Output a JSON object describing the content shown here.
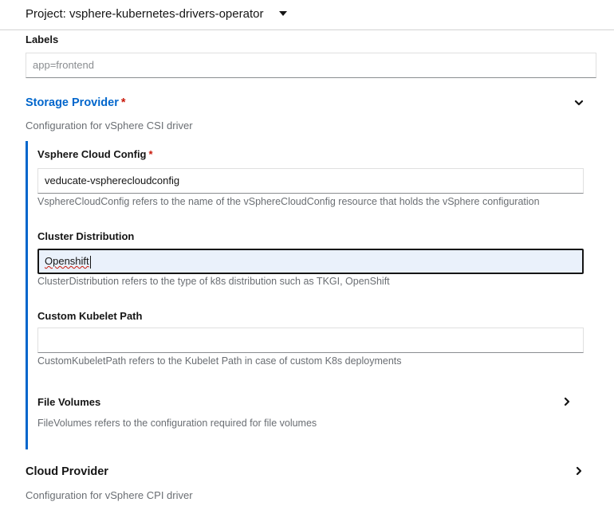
{
  "project": {
    "label": "Project: vsphere-kubernetes-drivers-operator"
  },
  "labels": {
    "label": "Labels",
    "placeholder": "app=frontend"
  },
  "storage_provider": {
    "title": "Storage Provider",
    "required_mark": "*",
    "description": "Configuration for vSphere CSI driver",
    "fields": {
      "cloud_config": {
        "label": "Vsphere Cloud Config",
        "required_mark": "*",
        "value": "veducate-vspherecloudconfig",
        "help": "VsphereCloudConfig refers to the name of the vSphereCloudConfig resource that holds the vSphere configuration"
      },
      "cluster_distribution": {
        "label": "Cluster Distribution",
        "value": "Openshift",
        "help": "ClusterDistribution refers to the type of k8s distribution such as TKGI, OpenShift"
      },
      "custom_kubelet_path": {
        "label": "Custom Kubelet Path",
        "value": "",
        "help": "CustomKubeletPath refers to the Kubelet Path in case of custom K8s deployments"
      },
      "file_volumes": {
        "title": "File Volumes",
        "help": "FileVolumes refers to the configuration required for file volumes"
      }
    }
  },
  "cloud_provider": {
    "title": "Cloud Provider",
    "description": "Configuration for vSphere CPI driver"
  },
  "icons": {
    "project_dropdown": "caret-down-icon",
    "storage_toggle": "chevron-down-icon",
    "file_volumes_toggle": "chevron-right-icon",
    "cloud_provider_toggle": "chevron-right-icon"
  },
  "colors": {
    "link_blue": "#0066cc",
    "required_red": "#c9190b",
    "focus_bg": "#eaf1fb",
    "help_gray": "#6a6e73"
  }
}
